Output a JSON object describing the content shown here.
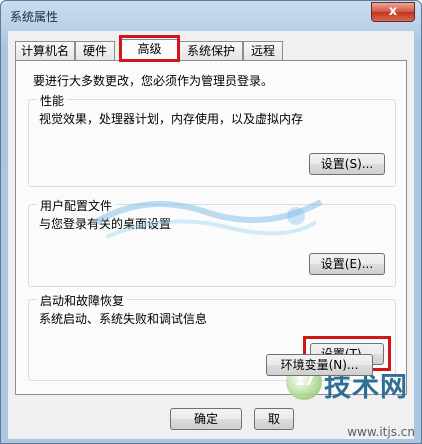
{
  "window": {
    "title": "系统属性",
    "close_label": "x"
  },
  "tabs": [
    {
      "label": "计算机名",
      "active": false
    },
    {
      "label": "硬件",
      "active": false
    },
    {
      "label": "高级",
      "active": true
    },
    {
      "label": "系统保护",
      "active": false
    },
    {
      "label": "远程",
      "active": false
    }
  ],
  "notice": "要进行大多数更改，您必须作为管理员登录。",
  "performance": {
    "title": "性能",
    "description": "视觉效果，处理器计划，内存使用，以及虚拟内存",
    "button": "设置(S)..."
  },
  "user_profiles": {
    "title": "用户配置文件",
    "description": "与您登录有关的桌面设置",
    "button": "设置(E)..."
  },
  "startup_recovery": {
    "title": "启动和故障恢复",
    "description": "系统启动、系统失败和调试信息",
    "button": "设置(T)..."
  },
  "env_button": "环境变量(N)...",
  "footer": {
    "ok": "确定",
    "cancel": "取"
  },
  "watermark": {
    "site_text": "www.itjs.cn",
    "logo_number": "17",
    "logo_text": "技术网"
  },
  "colors": {
    "highlight_red": "#d11518",
    "titlebar_blue": "#b7cfe7",
    "close_red": "#c94430"
  }
}
